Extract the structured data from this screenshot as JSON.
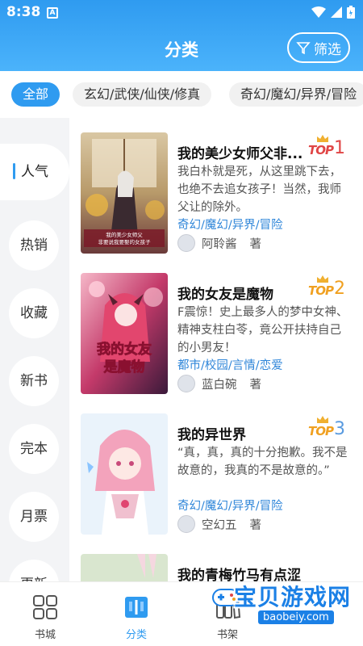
{
  "status_bar": {
    "time": "8:38",
    "app_icon_letter": "A"
  },
  "header": {
    "title": "分类",
    "filter_label": "筛选"
  },
  "tabs": [
    {
      "label": "全部",
      "active": true
    },
    {
      "label": "玄幻/武侠/仙侠/修真",
      "active": false
    },
    {
      "label": "奇幻/魔幻/异界/冒险",
      "active": false
    }
  ],
  "side_nav": [
    {
      "label": "人气",
      "active": true
    },
    {
      "label": "热销"
    },
    {
      "label": "收藏"
    },
    {
      "label": "新书"
    },
    {
      "label": "完本"
    },
    {
      "label": "月票"
    },
    {
      "label": "更新"
    }
  ],
  "books": [
    {
      "title": "我的美少女师父非...",
      "description": "我白朴就是死，从这里跳下去，也绝不去追女孩子！当然，我师父让的除外。",
      "tags": "奇幻/魔幻/异界/冒险",
      "author": "阿聆酱",
      "author_suffix": "著",
      "rank_label": "TOP",
      "rank": "1",
      "rank_color": "#e04545",
      "cover_text": "我的美少女师父\n非要说我要娶的女孩子"
    },
    {
      "title": "我的女友是魔物",
      "description": "F震惊！史上最多人的梦中女神、精神支柱白苓，竟公开扶持自己的小男友！",
      "tags": "都市/校园/言情/恋爱",
      "author": "蓝白碗",
      "author_suffix": "著",
      "rank_label": "TOP",
      "rank": "2",
      "rank_color": "#f0a020",
      "cover_text": "我的女友是魔物"
    },
    {
      "title": "我的异世界",
      "description": "“真，真，真的十分抱歉。我不是故意的，我真的不是故意的。”",
      "tags": "奇幻/魔幻/异界/冒险",
      "author": "空幻五",
      "author_suffix": "著",
      "rank_label": "TOP",
      "rank": "3",
      "rank_color": "#f0a020",
      "cover_text": ""
    },
    {
      "title": "我的青梅竹马有点涩",
      "description": "",
      "tags": "",
      "author": "",
      "author_suffix": "",
      "rank_label": "",
      "rank": "",
      "cover_text": ""
    }
  ],
  "bottom_nav": [
    {
      "label": "书城",
      "icon": "grid-icon",
      "active": false
    },
    {
      "label": "分类",
      "icon": "book-open-icon",
      "active": true
    },
    {
      "label": "书架",
      "icon": "shelf-icon",
      "active": false
    }
  ],
  "watermark": {
    "text": "宝贝游戏网",
    "url": "baobeiy.com"
  },
  "colors": {
    "accent": "#2f9bf0",
    "tag_blue": "#2f86d9",
    "top1_red": "#e04545",
    "top_orange": "#f0a020"
  }
}
